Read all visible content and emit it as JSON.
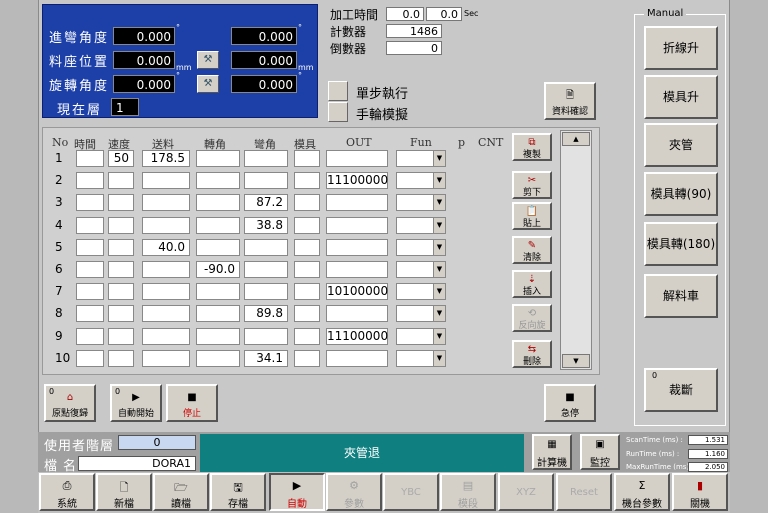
{
  "params": {
    "bend_label": "進彎角度",
    "feed_label": "料座位置",
    "rotate_label": "旋轉角度",
    "layer_label": "現在層",
    "bend_value": "0.000",
    "bend_value2": "0.000",
    "feed_value": "0.000",
    "feed_value2": "0.000",
    "rotate_value": "0.000",
    "rotate_value2": "0.000",
    "layer_value": "1",
    "unit_mm": "mm",
    "unit_deg": "°"
  },
  "stats": {
    "time_label": "加工時間",
    "time_a": "0.0",
    "time_b": "0.0",
    "time_unit": "Sec",
    "count_label": "計數器",
    "count_value": "1486",
    "countdown_label": "倒數器",
    "countdown_value": "0"
  },
  "options": {
    "step_exec": "單步執行",
    "handwheel_sim": "手輪模擬",
    "data_confirm": "資料確認"
  },
  "table": {
    "headers": [
      "No",
      "時間",
      "速度",
      "送料",
      "轉角",
      "彎角",
      "模具",
      "OUT",
      "Fun",
      "p",
      "CNT"
    ],
    "rows": [
      {
        "no": "1",
        "time": "",
        "speed": "50",
        "feed": "178.5",
        "rot": "",
        "bend": "",
        "die": "",
        "out": ""
      },
      {
        "no": "2",
        "time": "",
        "speed": "",
        "feed": "",
        "rot": "",
        "bend": "",
        "die": "",
        "out": "11100000"
      },
      {
        "no": "3",
        "time": "",
        "speed": "",
        "feed": "",
        "rot": "",
        "bend": "87.2",
        "die": "",
        "out": ""
      },
      {
        "no": "4",
        "time": "",
        "speed": "",
        "feed": "",
        "rot": "",
        "bend": "38.8",
        "die": "",
        "out": ""
      },
      {
        "no": "5",
        "time": "",
        "speed": "",
        "feed": "40.0",
        "rot": "",
        "bend": "",
        "die": "",
        "out": ""
      },
      {
        "no": "6",
        "time": "",
        "speed": "",
        "feed": "",
        "rot": "-90.0",
        "bend": "",
        "die": "",
        "out": ""
      },
      {
        "no": "7",
        "time": "",
        "speed": "",
        "feed": "",
        "rot": "",
        "bend": "",
        "die": "",
        "out": "10100000"
      },
      {
        "no": "8",
        "time": "",
        "speed": "",
        "feed": "",
        "rot": "",
        "bend": "89.8",
        "die": "",
        "out": ""
      },
      {
        "no": "9",
        "time": "",
        "speed": "",
        "feed": "",
        "rot": "",
        "bend": "",
        "die": "",
        "out": "11100000"
      },
      {
        "no": "10",
        "time": "",
        "speed": "",
        "feed": "",
        "rot": "",
        "bend": "34.1",
        "die": "",
        "out": ""
      }
    ]
  },
  "side_buttons": [
    "複製",
    "剪下",
    "貼上",
    "清除",
    "插入",
    "反向旋",
    "刪除"
  ],
  "manual": {
    "label": "Manual",
    "buttons": [
      "折線升",
      "模具升",
      "夾管",
      "模具轉(90)",
      "模具轉(180)",
      "解料車"
    ],
    "cut_label": "裁斷",
    "cut_num": "0"
  },
  "ops": {
    "home": "原點復歸",
    "auto_start": "自動開始",
    "stop": "停止",
    "estop": "急停",
    "num0": "0"
  },
  "footer": {
    "user_level_label": "使用者階層",
    "user_level": "0",
    "file_label": "檔名",
    "file_name": "DORA1",
    "status": "夾管退",
    "calc": "計算機",
    "monitor": "監控",
    "scan_label": "ScanTime (ms) :",
    "scan_value": "1.531",
    "run_label": "RunTime (ms) :",
    "run_value": "1.160",
    "maxrun_label": "MaxRunTime (ms) :",
    "maxrun_value": "2.050"
  },
  "menu": [
    "系統",
    "新檔",
    "讀檔",
    "存檔",
    "自動",
    "參數",
    "YBC",
    "模段",
    "XYZ",
    "Reset",
    "機台參數",
    "關機"
  ],
  "colors": {
    "panel_blue": "#1d3fa8",
    "status_teal": "#0f7f80",
    "stop_red": "#d00000"
  }
}
